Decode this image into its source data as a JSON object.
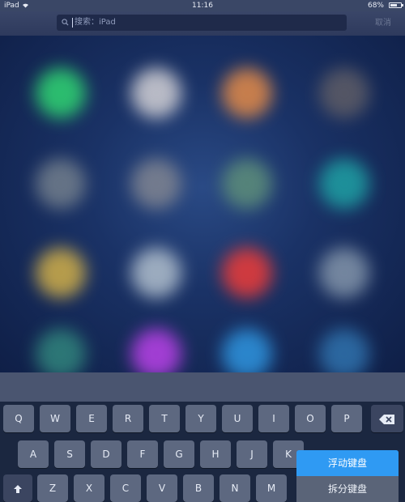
{
  "status_bar": {
    "device": "iPad",
    "wifi_icon": "wifi-icon",
    "time": "11:16",
    "battery": "68%",
    "battery_level": 0.68
  },
  "search": {
    "placeholder": "搜索：iPad",
    "icon": "search-icon",
    "cancel_label": "取消"
  },
  "home_icons": [
    {
      "color": "#2ecc71"
    },
    {
      "color": "#c9c9d0"
    },
    {
      "color": "#d9864a"
    },
    {
      "color": "#5a5a66"
    },
    {
      "color": "#6d7a8a"
    },
    {
      "color": "#7b8190"
    },
    {
      "color": "#5a8a7a"
    },
    {
      "color": "#1e9aa0"
    },
    {
      "color": "#c7a84a"
    },
    {
      "color": "#a9b8c8"
    },
    {
      "color": "#e23b3b"
    },
    {
      "color": "#7d8fa6"
    },
    {
      "color": "#2f7f7a"
    },
    {
      "color": "#b040e0"
    },
    {
      "color": "#2d8fd8"
    },
    {
      "color": "#2e6ea8"
    }
  ],
  "keyboard": {
    "row1": [
      "Q",
      "W",
      "E",
      "R",
      "T",
      "Y",
      "U",
      "I",
      "O",
      "P"
    ],
    "row2": [
      "A",
      "S",
      "D",
      "F",
      "G",
      "H",
      "J",
      "K"
    ],
    "row3": [
      "Z",
      "X",
      "C",
      "V",
      "B",
      "N",
      "M"
    ],
    "backspace_icon": "backspace-icon",
    "shift_icon": "shift-icon"
  },
  "keyboard_menu": {
    "floating_label": "浮动键盘",
    "split_label": "拆分键盘"
  },
  "colors": {
    "menu_highlight": "#2f9af3"
  }
}
